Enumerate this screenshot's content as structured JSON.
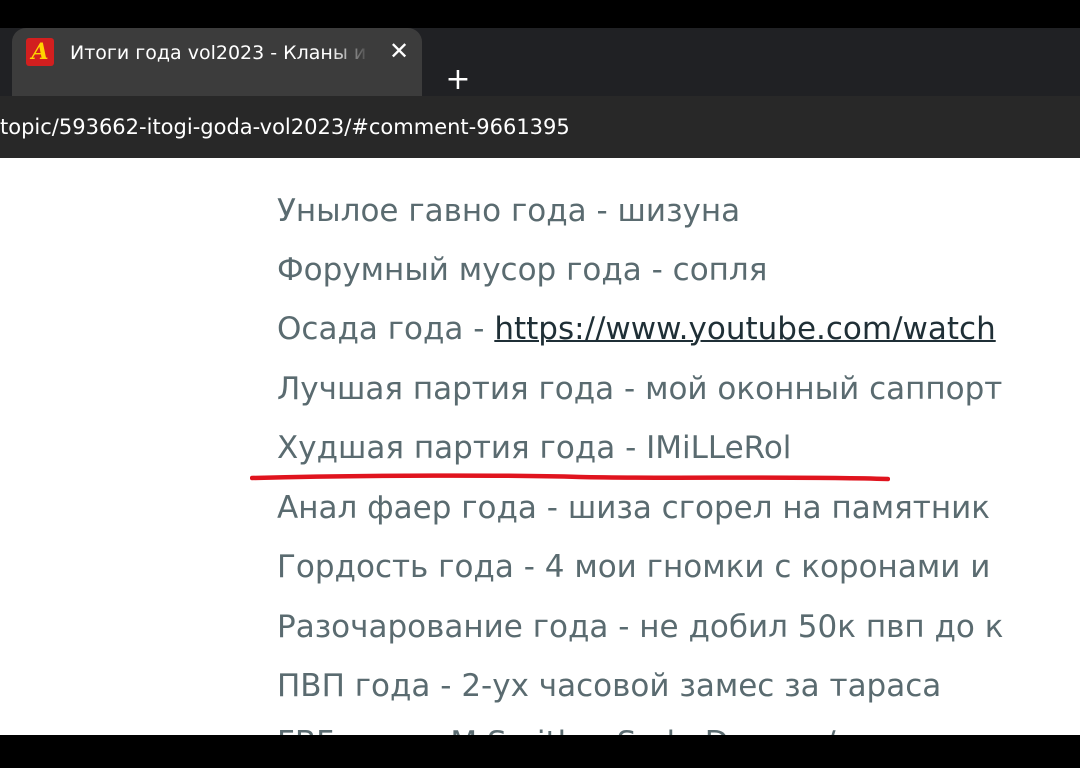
{
  "browser": {
    "tab_title": "Итоги года vol2023 - Кланы и",
    "favicon_letter": "A",
    "close_glyph": "✕",
    "new_tab_glyph": "+",
    "url": "topic/593662-itogi-goda-vol2023/#comment-9661395"
  },
  "post": {
    "lines": [
      {
        "text": "Унылое гавно года -  шизуна"
      },
      {
        "text": "Форумный мусор года - сопля"
      },
      {
        "prefix": "Осада года - ",
        "link": "https://www.youtube.com/watch"
      },
      {
        "text": "Лучшая партия года - мой оконный саппорт"
      },
      {
        "text": "Худшая партия года - IMiLLeRol"
      },
      {
        "text": "Анал фаер года -  шиза сгорел на памятник"
      },
      {
        "text": "Гордость года - 4 мои гномки с коронами и"
      },
      {
        "text": "Разочарование года - не добил 50к пвп до к"
      },
      {
        "text": "ПВП года - 2-ух часовой замес за тараса"
      },
      {
        "text": "FBF года - M Smith... Sml...Dreams/"
      }
    ]
  },
  "annotation": {
    "color": "#e0141e"
  },
  "colors": {
    "tab_bg": "#3c3c3c",
    "strip_bg": "#202124",
    "omnibox_bg": "#282828",
    "text": "#5a6b70",
    "link": "#1f2f36"
  }
}
